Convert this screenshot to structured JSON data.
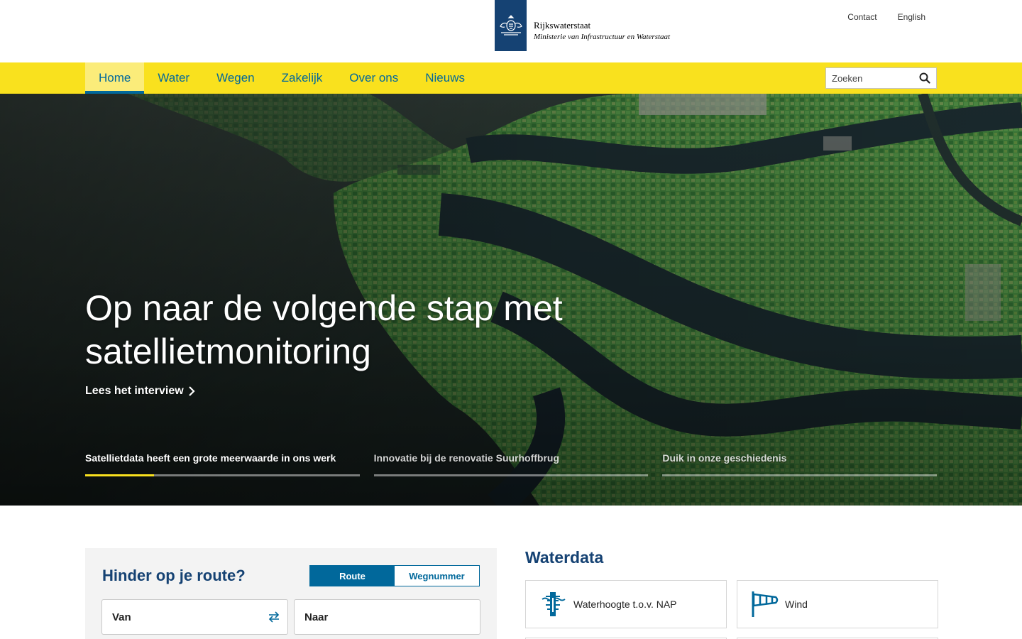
{
  "header": {
    "org_name": "Rijkswaterstaat",
    "ministry": "Ministerie van Infrastructuur en Waterstaat",
    "util_links": [
      "Contact",
      "English"
    ]
  },
  "nav": {
    "items": [
      {
        "label": "Home",
        "active": true
      },
      {
        "label": "Water",
        "active": false
      },
      {
        "label": "Wegen",
        "active": false
      },
      {
        "label": "Zakelijk",
        "active": false
      },
      {
        "label": "Over ons",
        "active": false
      },
      {
        "label": "Nieuws",
        "active": false
      }
    ],
    "search_placeholder": "Zoeken"
  },
  "hero": {
    "title": "Op naar de volgende stap met satellietmonitoring",
    "cta": "Lees het interview",
    "slides": [
      {
        "label": "Satellietdata heeft een grote meerwaarde in ons werk",
        "active": true,
        "progress": 0.25
      },
      {
        "label": "Innovatie bij de renovatie Suurhoffbrug",
        "active": false,
        "progress": 0
      },
      {
        "label": "Duik in onze geschiedenis",
        "active": false,
        "progress": 0
      }
    ]
  },
  "hinder": {
    "title": "Hinder op je route?",
    "toggle": [
      {
        "label": "Route",
        "selected": true
      },
      {
        "label": "Wegnummer",
        "selected": false
      }
    ],
    "from_placeholder": "Van",
    "to_placeholder": "Naar"
  },
  "waterdata": {
    "title": "Waterdata",
    "cards": [
      {
        "label": "Waterhoogte t.o.v. NAP",
        "icon": "water-gauge-icon"
      },
      {
        "label": "Wind",
        "icon": "windsock-icon"
      }
    ]
  },
  "colors": {
    "nav_yellow": "#f9e11e",
    "brand_blue": "#154273",
    "link_blue": "#01689b"
  }
}
